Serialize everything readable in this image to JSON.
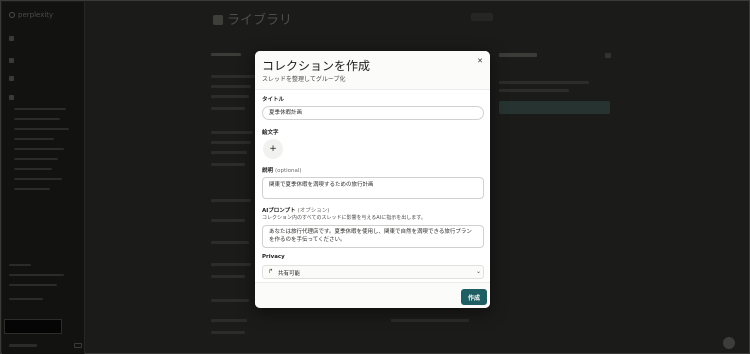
{
  "app": {
    "brand": "perplexity",
    "page_title": "ライブラリ"
  },
  "modal": {
    "title": "コレクションを作成",
    "subtitle": "スレッドを整理してグループ化",
    "close_icon": "✕",
    "title_field": {
      "label": "タイトル",
      "value": "夏季休暇計画"
    },
    "emoji_field": {
      "label": "絵文字",
      "button_icon": "+"
    },
    "description_field": {
      "label": "説明",
      "optional": "(optional)",
      "value": "関東で夏季休暇を満喫するための旅行計画"
    },
    "ai_prompt_field": {
      "label": "AIプロンプト",
      "optional": "(オプション)",
      "help": "コレクション内のすべてのスレッドに影響を与えるAIに指示を出します。",
      "value": "あなたは旅行代理店です。夏季休暇を使用し、関東で自然を満喫できる旅行プランを作るのを手伝ってください。"
    },
    "privacy_field": {
      "label": "Privacy",
      "icon": "share-icon",
      "value": "共有可能",
      "chevron": "⌄"
    },
    "submit_label": "作成"
  },
  "colors": {
    "accent": "#1f5f63",
    "overlay": "#1b1b1a"
  }
}
